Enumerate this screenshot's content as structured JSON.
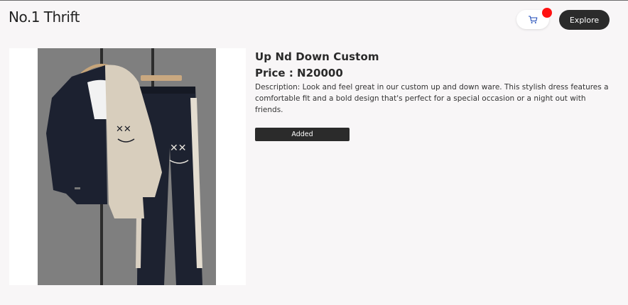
{
  "header": {
    "brand": "No.1 Thrift",
    "cart_icon": "cart-icon",
    "explore_label": "Explore",
    "badge_color": "#ff1111"
  },
  "product": {
    "image_icon": "product-photo-tracksuit",
    "title": "Up Nd Down Custom",
    "price": "Price : N20000",
    "description": "Description: Look and feel great in our custom up and down ware. This stylish dress features a comfortable fit and a bold design that's perfect for a special occasion or a night out with friends.",
    "button_label": "Added"
  },
  "colors": {
    "accent_dark": "#2b2b2b",
    "page_bg": "#f8f6f7"
  }
}
